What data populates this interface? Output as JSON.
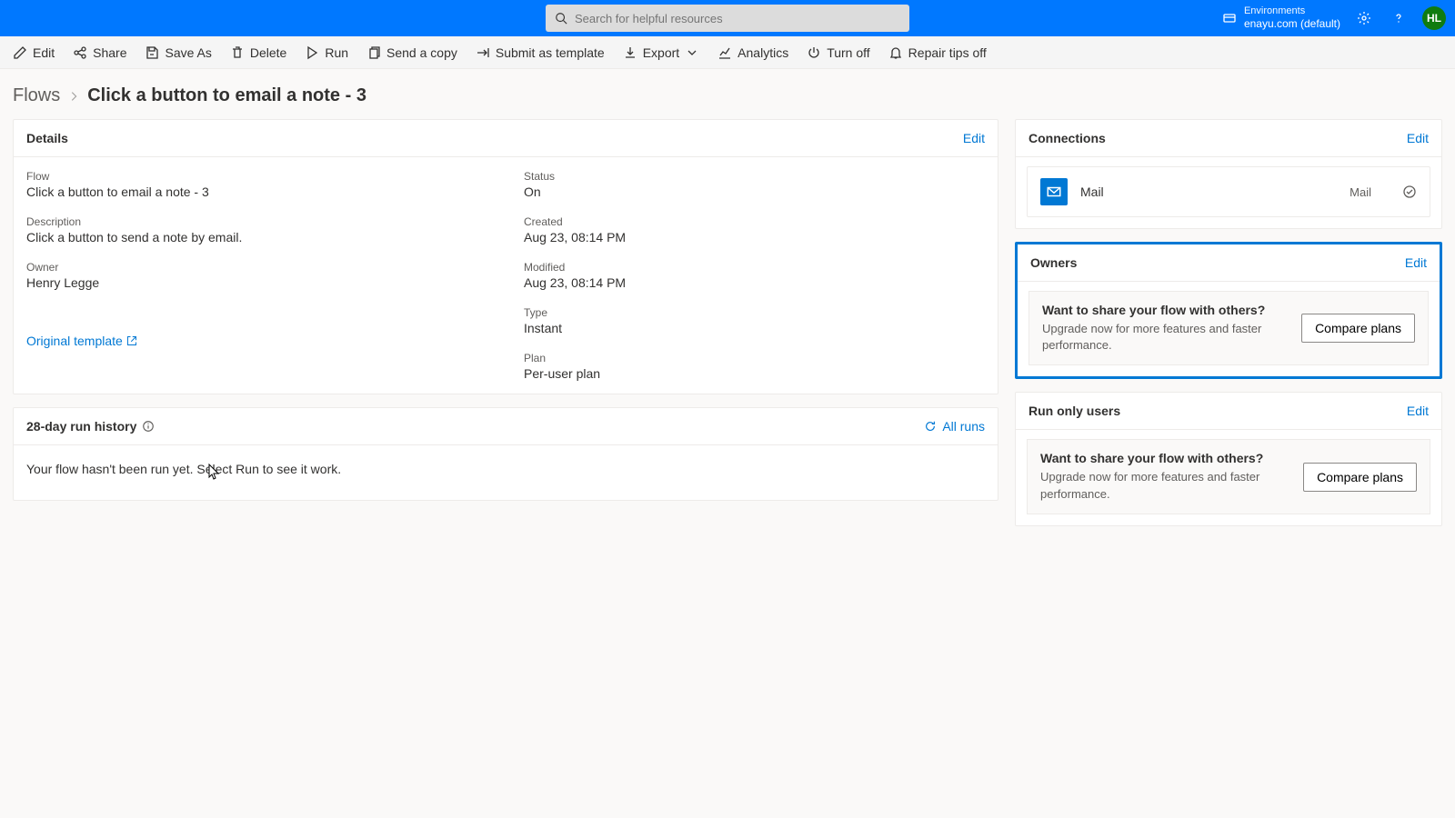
{
  "header": {
    "search_placeholder": "Search for helpful resources",
    "env_label": "Environments",
    "env_value": "enayu.com (default)",
    "avatar_initials": "HL"
  },
  "commands": {
    "edit": "Edit",
    "share": "Share",
    "save_as": "Save As",
    "delete": "Delete",
    "run": "Run",
    "send_copy": "Send a copy",
    "submit_template": "Submit as template",
    "export": "Export",
    "analytics": "Analytics",
    "turn_off": "Turn off",
    "repair_tips_off": "Repair tips off"
  },
  "breadcrumb": {
    "root": "Flows",
    "current": "Click a button to email a note - 3"
  },
  "details": {
    "title": "Details",
    "edit": "Edit",
    "flow_label": "Flow",
    "flow_value": "Click a button to email a note - 3",
    "desc_label": "Description",
    "desc_value": "Click a button to send a note by email.",
    "owner_label": "Owner",
    "owner_value": "Henry Legge",
    "status_label": "Status",
    "status_value": "On",
    "created_label": "Created",
    "created_value": "Aug 23, 08:14 PM",
    "modified_label": "Modified",
    "modified_value": "Aug 23, 08:14 PM",
    "type_label": "Type",
    "type_value": "Instant",
    "plan_label": "Plan",
    "plan_value": "Per-user plan",
    "original_template": "Original template"
  },
  "run_history": {
    "title": "28-day run history",
    "all_runs": "All runs",
    "empty": "Your flow hasn't been run yet. Select Run to see it work."
  },
  "connections": {
    "title": "Connections",
    "edit": "Edit",
    "item_name": "Mail",
    "item_type": "Mail"
  },
  "owners": {
    "title": "Owners",
    "edit": "Edit",
    "promo_title": "Want to share your flow with others?",
    "promo_sub": "Upgrade now for more features and faster performance.",
    "compare": "Compare plans"
  },
  "run_only": {
    "title": "Run only users",
    "edit": "Edit",
    "promo_title": "Want to share your flow with others?",
    "promo_sub": "Upgrade now for more features and faster performance.",
    "compare": "Compare plans"
  }
}
